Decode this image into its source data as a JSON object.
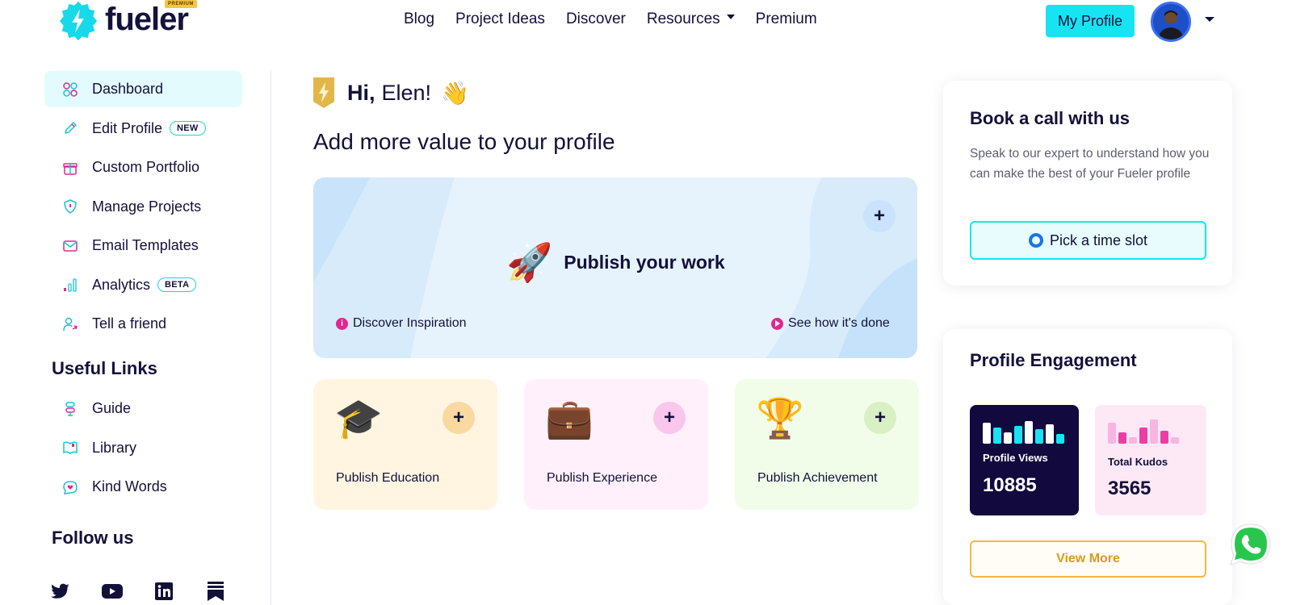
{
  "brand": {
    "name": "fueler",
    "badge": "PREMIUM"
  },
  "nav": {
    "items": [
      "Blog",
      "Project Ideas",
      "Discover",
      "Resources",
      "Premium"
    ]
  },
  "header": {
    "profile_button": "My Profile"
  },
  "sidebar": {
    "items": [
      {
        "label": "Dashboard",
        "icon": "grid-icon",
        "active": true
      },
      {
        "label": "Edit Profile",
        "icon": "pencil-icon",
        "badge": "NEW"
      },
      {
        "label": "Custom Portfolio",
        "icon": "gift-icon"
      },
      {
        "label": "Manage Projects",
        "icon": "shield-icon"
      },
      {
        "label": "Email Templates",
        "icon": "mail-icon"
      },
      {
        "label": "Analytics",
        "icon": "bar-chart-icon",
        "badge": "BETA"
      },
      {
        "label": "Tell a friend",
        "icon": "user-share-icon"
      }
    ],
    "useful_links_heading": "Useful Links",
    "useful_links": [
      {
        "label": "Guide",
        "icon": "guide-icon"
      },
      {
        "label": "Library",
        "icon": "book-icon"
      },
      {
        "label": "Kind Words",
        "icon": "chat-heart-icon"
      }
    ],
    "follow_heading": "Follow us",
    "social": [
      "twitter-icon",
      "youtube-icon",
      "linkedin-icon",
      "bookmark-icon"
    ]
  },
  "main": {
    "greeting_hi": "Hi,",
    "greeting_name": "Elen!",
    "section_title": "Add more value to your profile",
    "publish": {
      "title": "Publish your work",
      "link_left": "Discover Inspiration",
      "link_right": "See how it's done"
    },
    "cards": [
      {
        "label": "Publish Education",
        "icon": "graduation-cap-icon",
        "bg": "#fff5e1",
        "plus_bg": "#f9d9a0"
      },
      {
        "label": "Publish Experience",
        "icon": "briefcase-icon",
        "bg": "#fff0fb",
        "plus_bg": "#f9c6ec"
      },
      {
        "label": "Publish Achievement",
        "icon": "trophy-icon",
        "bg": "#f1fde8",
        "plus_bg": "#d9efc4"
      }
    ]
  },
  "right": {
    "book": {
      "title": "Book a call with us",
      "text": "Speak to our expert to understand how you can make the best of your Fueler profile",
      "button": "Pick a time slot"
    },
    "engagement": {
      "title": "Profile Engagement",
      "views_label": "Profile Views",
      "views_value": "10885",
      "kudos_label": "Total Kudos",
      "kudos_value": "3565",
      "button": "View More"
    }
  },
  "colors": {
    "accent": "#16e4f3",
    "navy": "#12113a",
    "pink": "#e0288f",
    "gold": "#f0b847"
  }
}
